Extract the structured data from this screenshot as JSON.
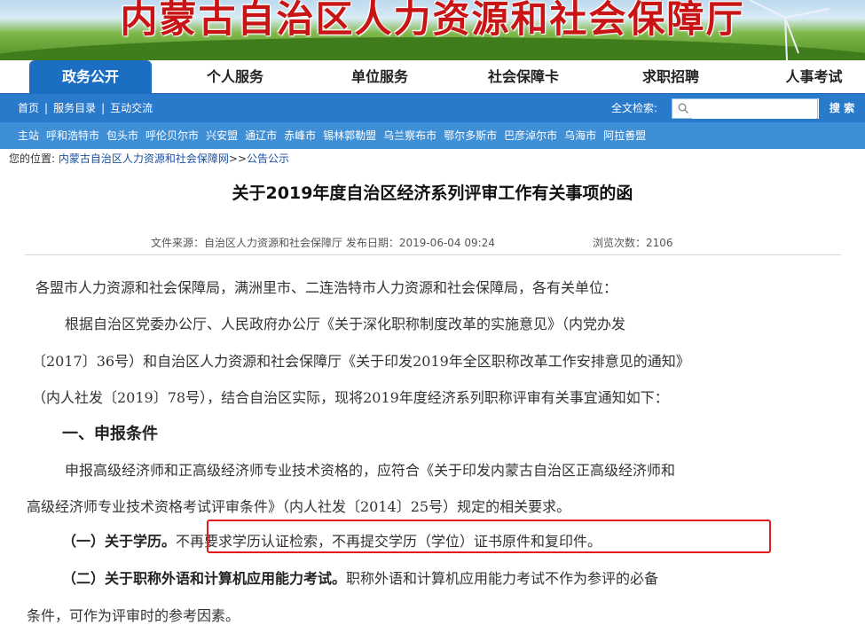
{
  "banner": {
    "title": "内蒙古自治区人力资源和社会保障厅"
  },
  "nav": {
    "items": [
      "政务公开",
      "个人服务",
      "单位服务",
      "社会保障卡",
      "求职招聘",
      "人事考试"
    ]
  },
  "subbar": {
    "links": [
      "首页",
      "服务目录",
      "互动交流"
    ],
    "search_label": "全文检索:",
    "search_placeholder": "",
    "search_button": "搜 索"
  },
  "cities": [
    "主站",
    "呼和浩特市",
    "包头市",
    "呼伦贝尔市",
    "兴安盟",
    "通辽市",
    "赤峰市",
    "锡林郭勒盟",
    "乌兰察布市",
    "鄂尔多斯市",
    "巴彦淖尔市",
    "乌海市",
    "阿拉善盟"
  ],
  "breadcrumb": {
    "prefix": "您的位置:",
    "site": "内蒙古自治区人力资源和社会保障网",
    "arrow": ">>",
    "section": "公告公示"
  },
  "article": {
    "title": "关于2019年度自治区经济系列评审工作有关事项的函",
    "source": "文件来源：自治区人力资源和社会保障厅 发布日期：2019-06-04 09:24",
    "views": "浏览次数：2106",
    "p1": "各盟市人力资源和社会保障局，满洲里市、二连浩特市人力资源和社会保障局，各有关单位：",
    "p2_l1": "根据自治区党委办公厅、人民政府办公厅《关于深化职称制度改革的实施意见》（内党办发",
    "p2_l2": "〔2017〕36号）和自治区人力资源和社会保障厅《关于印发2019年全区职称改革工作安排意见的通知》",
    "p2_l3": "（内人社发〔2019〕78号），结合自治区实际，现将2019年度经济系列职称评审有关事宜通知如下：",
    "h1": "一、申报条件",
    "p3_l1": "申报高级经济师和正高级经济师专业技术资格的，应符合《关于印发内蒙古自治区正高级经济师和",
    "p3_l2": "高级经济师专业技术资格考试评审条件》（内人社发〔2014〕25号）规定的相关要求。",
    "s1_bold": "（一）关于学历。",
    "s1_text": "不再要求学历认证检索，不再提交学历（学位）证书原件和复印件。",
    "s2_bold": "（二）关于职称外语和计算机应用能力考试。",
    "s2_text": "职称外语和计算机应用能力考试不作为参评的必备",
    "s2_l2": "条件，可作为评审时的参考因素。"
  },
  "colors": {
    "nav_active": "#1b6ec2",
    "bar": "#2a7acb",
    "highlight": "#e21b1b"
  }
}
